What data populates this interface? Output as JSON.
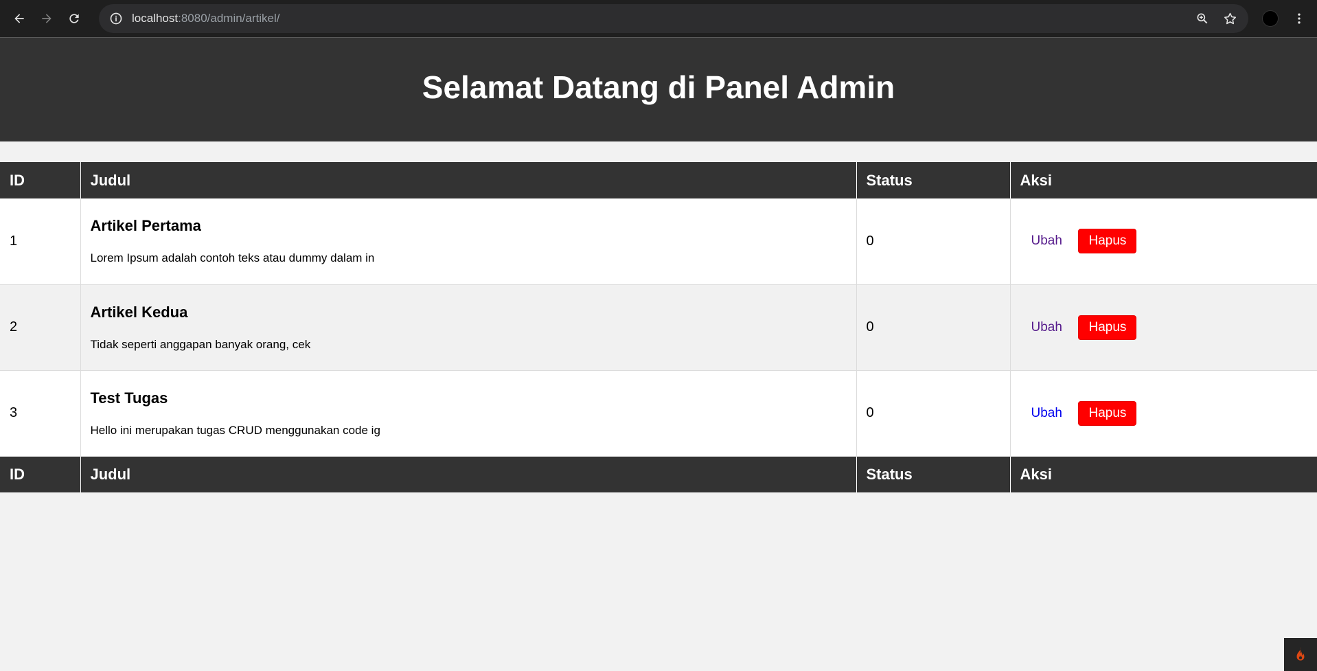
{
  "browser": {
    "url_host": "localhost",
    "url_rest": ":8080/admin/artikel/"
  },
  "header": {
    "title": "Selamat Datang di Panel Admin"
  },
  "table": {
    "columns": [
      "ID",
      "Judul",
      "Status",
      "Aksi"
    ],
    "rows": [
      {
        "id": "1",
        "title": "Artikel Pertama",
        "desc": "Lorem Ipsum adalah contoh teks atau dummy dalam in",
        "status": "0",
        "edit_label": "Ubah",
        "delete_label": "Hapus"
      },
      {
        "id": "2",
        "title": "Artikel Kedua",
        "desc": "Tidak seperti anggapan banyak orang, cek",
        "status": "0",
        "edit_label": "Ubah",
        "delete_label": "Hapus"
      },
      {
        "id": "3",
        "title": "Test Tugas",
        "desc": "Hello ini merupakan tugas CRUD menggunakan code ig",
        "status": "0",
        "edit_label": "Ubah",
        "delete_label": "Hapus"
      }
    ]
  },
  "colors": {
    "header_bg": "#333333",
    "delete_button": "#ff0000",
    "visited_link": "#551a8b",
    "link": "#0000ee"
  },
  "icons": [
    "back-icon",
    "forward-icon",
    "reload-icon",
    "site-info-icon",
    "zoom-icon",
    "bookmark-star-icon",
    "profile-avatar",
    "kebab-menu-icon",
    "codeigniter-flame-icon"
  ]
}
